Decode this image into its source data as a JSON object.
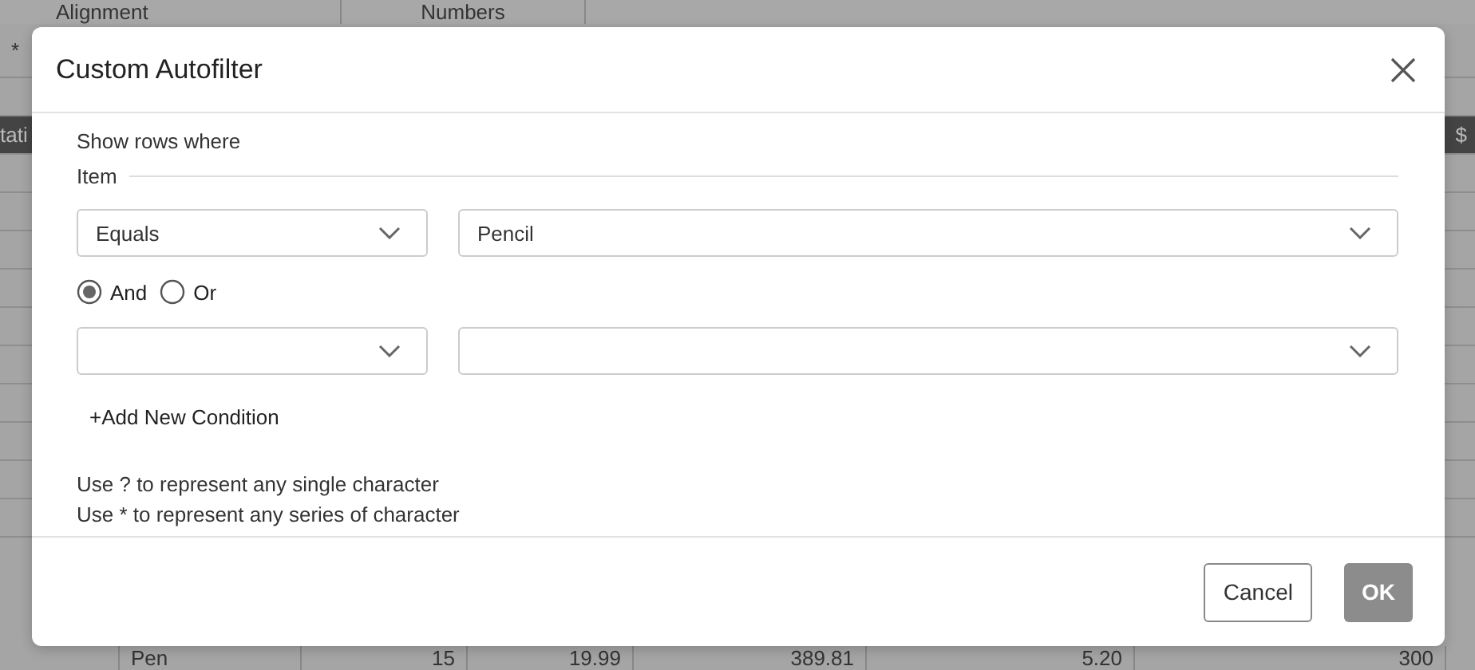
{
  "sheet": {
    "header": [
      "Alignment",
      "Numbers"
    ],
    "row_marker": "*",
    "left_cut": "tati",
    "right_cut": "$",
    "bottom_row": [
      "Pen",
      "15",
      "19.99",
      "389.81",
      "5.20",
      "300"
    ]
  },
  "dialog": {
    "title": "Custom Autofilter",
    "intro": "Show rows where",
    "field": "Item",
    "conditions": [
      {
        "kind": "filled",
        "operator": "Equals",
        "value": "Pencil"
      },
      {
        "kind": "blank"
      }
    ],
    "junction": [
      {
        "label": "And",
        "selected": true
      },
      {
        "label": "Or",
        "selected": false
      }
    ],
    "add_condition": "+Add New Condition",
    "hints": [
      "Use ? to represent any single character",
      "Use * to represent any series of character"
    ],
    "buttons": [
      {
        "label": "Cancel",
        "kind": "secondary"
      },
      {
        "label": "OK",
        "kind": "primary"
      }
    ]
  }
}
